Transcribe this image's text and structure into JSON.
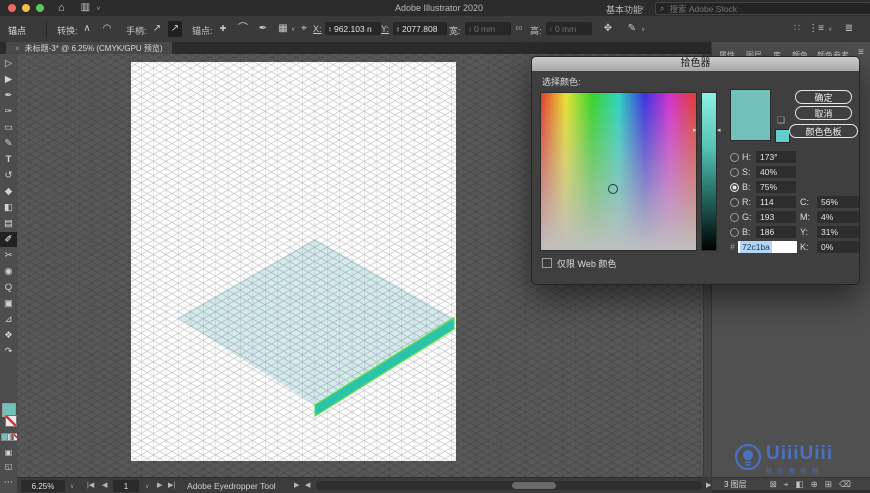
{
  "window": {
    "app_title": "Adobe Illustrator 2020",
    "workspace": "基本功能",
    "search_placeholder": "搜索 Adobe Stock"
  },
  "control_bar": {
    "context_label": "锚点",
    "convert_label": "转换:",
    "handles_label": "手柄:",
    "anchor_ops_label": "锚点:",
    "x_label": "X:",
    "x_value": "962.103 n",
    "y_label": "Y:",
    "y_value": "2077.808",
    "w_label": "宽:",
    "w_value": "0 mm",
    "h_label": "高:",
    "h_value": "0 mm"
  },
  "document_tab": {
    "close": "×",
    "title": "未标题-3* @ 6.25% (CMYK/GPU 预览)"
  },
  "toolbar": {
    "tools": [
      {
        "name": "selection-tool",
        "glyph": "▷"
      },
      {
        "name": "direct-selection-tool",
        "glyph": "▶"
      },
      {
        "name": "pen-tool",
        "glyph": "✒"
      },
      {
        "name": "curvature-tool",
        "glyph": "✑"
      },
      {
        "name": "rectangle-tool",
        "glyph": "▭"
      },
      {
        "name": "paintbrush-tool",
        "glyph": "✎"
      },
      {
        "name": "type-tool",
        "glyph": "T"
      },
      {
        "name": "rotate-tool",
        "glyph": "↺"
      },
      {
        "name": "eraser-tool",
        "glyph": "◆"
      },
      {
        "name": "shape-builder-tool",
        "glyph": "◧"
      },
      {
        "name": "gradient-tool",
        "glyph": "▤"
      },
      {
        "name": "eyedropper-tool",
        "glyph": "✐",
        "active": true
      },
      {
        "name": "scissors-tool",
        "glyph": "✂"
      },
      {
        "name": "blend-tool",
        "glyph": "◉"
      },
      {
        "name": "zoom-tool",
        "glyph": "Q"
      },
      {
        "name": "artboard-tool",
        "glyph": "▣"
      },
      {
        "name": "perspective-grid-tool",
        "glyph": "⊿"
      },
      {
        "name": "symbol-sprayer-tool",
        "glyph": "❖"
      },
      {
        "name": "hand-tool",
        "glyph": "↷"
      }
    ]
  },
  "color_picker": {
    "title": "拾色器",
    "select_label": "选择颜色:",
    "ok_label": "确定",
    "cancel_label": "取消",
    "swatches_label": "颜色色板",
    "h_label": "H:",
    "h_value": "173°",
    "s_label": "S:",
    "s_value": "40%",
    "b_label": "B:",
    "b_value": "75%",
    "r_label": "R:",
    "r_value": "114",
    "g_label": "G:",
    "g_value": "193",
    "b2_label": "B:",
    "b2_value": "186",
    "hex_label": "#",
    "hex_value": "72c1ba",
    "c_label": "C:",
    "c_value": "56%",
    "m_label": "M:",
    "m_value": "4%",
    "y_label": "Y:",
    "y_value": "31%",
    "k_label": "K:",
    "k_value": "0%",
    "web_only_label": "仅限 Web 颜色"
  },
  "right_panel": {
    "tabs": [
      "属性",
      "图层",
      "库",
      "颜色",
      "颜色参考"
    ],
    "layers_status": "3 图层"
  },
  "status_bar": {
    "zoom_value": "6.25%",
    "artboard_value": "1",
    "tool_name": "Adobe Eyedropper Tool"
  },
  "watermark": {
    "text": "UiiiUiii",
    "subtext": "优优教程网"
  },
  "colors": {
    "accent_teal": "#72c1ba",
    "shape_face": "#d4eaec",
    "shape_side": "#2cc2ab",
    "selection_green": "#58e04b",
    "web_safe_swatch": "#66cccc",
    "watermark_blue": "#4976d7",
    "traffic_red": "#ee6a5f",
    "traffic_yellow": "#f5bf4f",
    "traffic_green": "#61c454"
  },
  "icons": {
    "home": "⌂",
    "layout": "▥",
    "chevron": "∨",
    "search": "⌕",
    "convert_corner": "∧",
    "convert_smooth": "◠",
    "handle_show": "↗",
    "handle_hide": "↗",
    "anchor_add": "✚",
    "anchor_arc": "⌒",
    "anchor_pen": "✒",
    "snap_grid": "▦",
    "reference_point": "⌖",
    "transform": "✥",
    "reshape": "✎",
    "doc_grid": "∷",
    "align": "⋮≡",
    "stack": "≣",
    "link": "∞",
    "menu": "≡",
    "nav_first": "|◀",
    "nav_prev": "◀",
    "nav_next": "▶",
    "nav_last": "▶|",
    "scroll_left": "◀",
    "scroll_right": "▶",
    "panel_arrow": "▶",
    "collect": "⊠",
    "locate": "⌖",
    "mask": "◧",
    "sublayer": "⊕",
    "new_layer": "⊞",
    "delete": "⌫",
    "slider_left": "▸",
    "slider_right": "◂",
    "gamut_cube": "❑",
    "ellipsis": "⋯",
    "draw_mode": "▣",
    "screen_mode": "◱",
    "stepper_up": "▲",
    "stepper_down": "▼"
  }
}
